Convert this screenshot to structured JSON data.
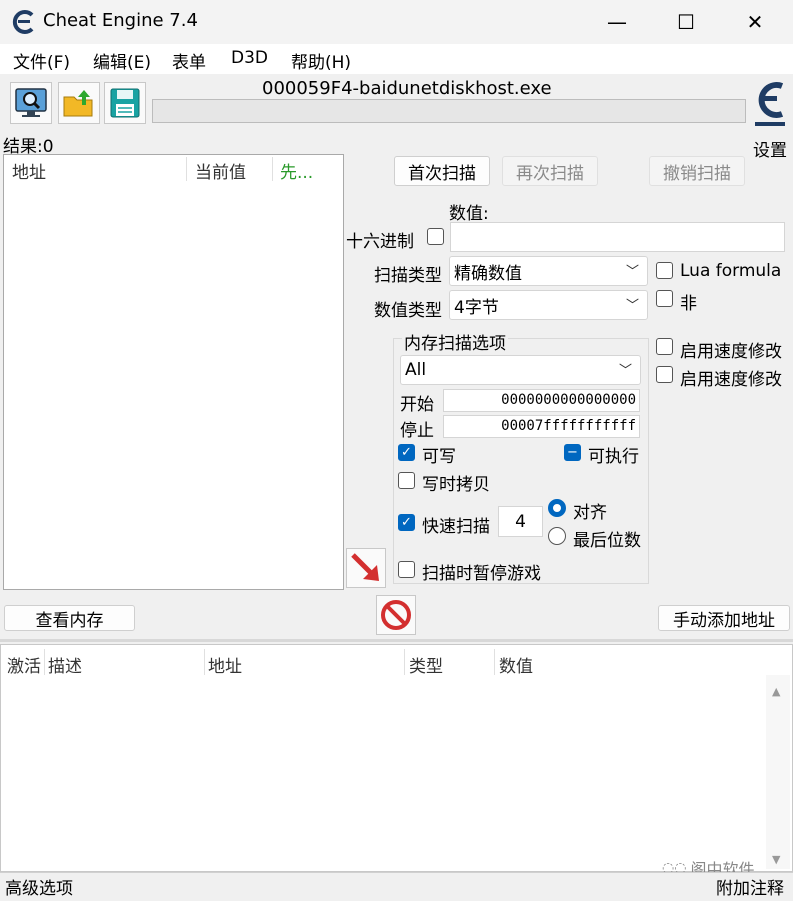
{
  "window": {
    "title": "Cheat Engine 7.4",
    "minimize_label": "—",
    "maximize_label": "☐",
    "close_label": "✕"
  },
  "menu": [
    "文件(F)",
    "编辑(E)",
    "表单",
    "D3D",
    "帮助(H)"
  ],
  "process_name": "000059F4-baidunetdiskhost.exe",
  "settings_label": "设置",
  "results_label": "结果:0",
  "result_list": {
    "col_address": "地址",
    "col_current": "当前值",
    "col_previous": "先..."
  },
  "scan_buttons": {
    "first": "首次扫描",
    "next": "再次扫描",
    "undo": "撤销扫描"
  },
  "value_label": "数值:",
  "hex_label": "十六进制",
  "scan_type_label": "扫描类型",
  "scan_type_value": "精确数值",
  "value_type_label": "数值类型",
  "value_type_value": "4字节",
  "lua_formula_label": "Lua formula",
  "not_label": "非",
  "speedhack_1": "启用速度修改",
  "speedhack_2": "启用速度修改",
  "memory_options": {
    "title": "内存扫描选项",
    "region_value": "All",
    "start_label": "开始",
    "start_value": "0000000000000000",
    "stop_label": "停止",
    "stop_value": "00007fffffffffff",
    "writable_label": "可写",
    "executable_label": "可执行",
    "copy_on_write_label": "写时拷贝",
    "fast_scan_label": "快速扫描",
    "fast_scan_value": "4",
    "align_label": "对齐",
    "last_digits_label": "最后位数",
    "pause_label": "扫描时暂停游戏"
  },
  "view_memory_label": "查看内存",
  "add_address_label": "手动添加地址",
  "cheat_table": {
    "col_active": "激活",
    "col_desc": "描述",
    "col_address": "地址",
    "col_type": "类型",
    "col_value": "数值"
  },
  "footer": {
    "advanced": "高级选项",
    "comments": "附加注释"
  },
  "watermark": "阁中软件",
  "colors": {
    "accent": "#0067c0",
    "logo": "#1f3c64"
  }
}
